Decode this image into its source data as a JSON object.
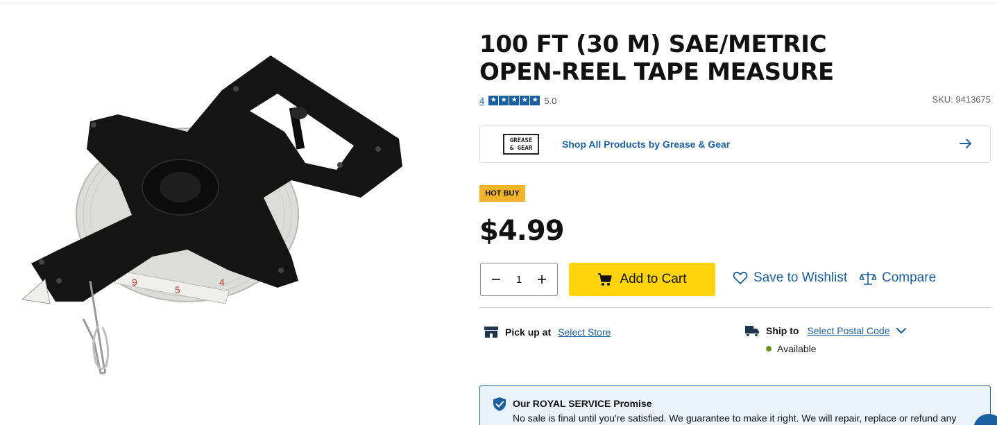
{
  "product": {
    "title_line1": "100 FT (30 M) SAE/METRIC",
    "title_line2": "OPEN-REEL TAPE MEASURE",
    "rating": {
      "count": "4",
      "stars": 5,
      "value": "5.0"
    },
    "sku": "SKU: 9413675",
    "image_alt": "Open-reel tape measure",
    "tape_numbers": [
      "9",
      "5",
      "4"
    ]
  },
  "brand": {
    "logo_line1": "GREASE",
    "logo_line2": "& GEAR",
    "link_text": "Shop All Products by Grease & Gear"
  },
  "badge": {
    "label": "HOT BUY"
  },
  "price": "$4.99",
  "quantity": {
    "value": "1"
  },
  "actions": {
    "add_to_cart": "Add to Cart",
    "wishlist": "Save to Wishlist",
    "compare": "Compare"
  },
  "fulfillment": {
    "pickup_label": "Pick up at",
    "pickup_link": "Select Store",
    "ship_label": "Ship to",
    "ship_link": "Select Postal Code",
    "availability": "Available"
  },
  "promise": {
    "title": "Our ROYAL SERVICE Promise",
    "text": "No sale is final until you're satisfied. We guarantee to make it right. We will repair, replace or refund any"
  },
  "colors": {
    "link_blue": "#1a5fa0",
    "cart_yellow": "#ffd30d",
    "badge_gold": "#f0b32a",
    "available_green": "#6a9a22"
  },
  "icons": [
    "cart-icon",
    "heart-icon",
    "scale-icon",
    "store-icon",
    "truck-icon",
    "shield-check-icon",
    "arrow-right-icon",
    "chevron-down-icon",
    "minus-icon",
    "plus-icon"
  ]
}
